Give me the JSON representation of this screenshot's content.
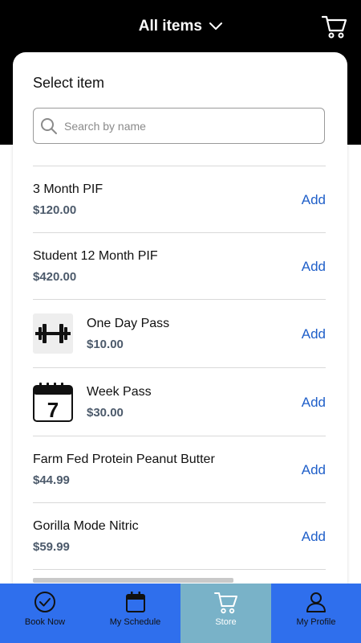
{
  "header": {
    "title": "All items"
  },
  "panel": {
    "title": "Select item",
    "search_placeholder": "Search by name"
  },
  "items": [
    {
      "name": "3 Month PIF",
      "price": "$120.00",
      "action": "Add"
    },
    {
      "name": "Student 12 Month PIF",
      "price": "$420.00",
      "action": "Add"
    },
    {
      "name": "One Day Pass",
      "price": "$10.00",
      "action": "Add",
      "icon": "dumbbell-icon"
    },
    {
      "name": "Week Pass",
      "price": "$30.00",
      "action": "Add",
      "icon": "calendar-icon",
      "icon_text": "7"
    },
    {
      "name": "Farm Fed Protein Peanut Butter",
      "price": "$44.99",
      "action": "Add"
    },
    {
      "name": "Gorilla Mode Nitric",
      "price": "$59.99",
      "action": "Add"
    }
  ],
  "tabs": [
    {
      "label": "Book Now",
      "icon": "check-circle-icon"
    },
    {
      "label": "My Schedule",
      "icon": "calendar-icon"
    },
    {
      "label": "Store",
      "icon": "cart-icon",
      "active": true
    },
    {
      "label": "My Profile",
      "icon": "user-icon"
    }
  ],
  "colors": {
    "header_bg": "#000000",
    "tab_bar": "#2f6fed",
    "tab_active": "#79b2c8",
    "add_link": "#1f5fc9",
    "price_text": "#4c5a6b"
  }
}
